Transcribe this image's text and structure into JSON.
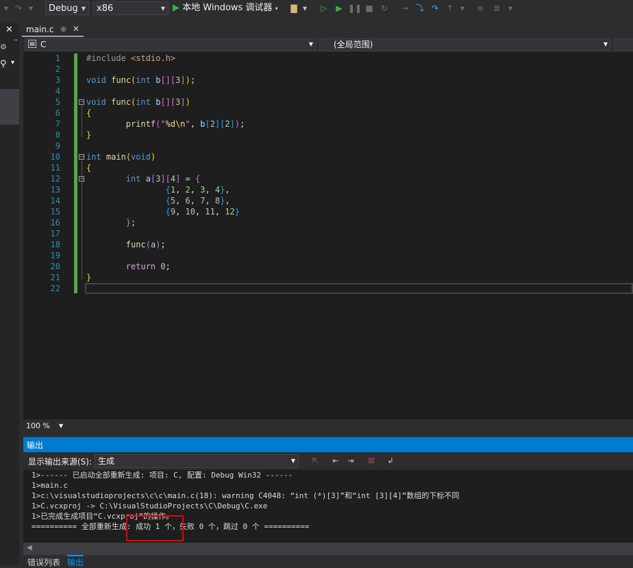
{
  "toolbar": {
    "config": "Debug",
    "platform": "x86",
    "run_label": "本地 Windows 调试器"
  },
  "tab": {
    "title": "main.c",
    "pin": "⊕",
    "close": "✕"
  },
  "left_strip": {
    "close": "✕"
  },
  "navbar": {
    "file": "C",
    "scope": "(全局范围)"
  },
  "editor": {
    "line_numbers": [
      "1",
      "2",
      "3",
      "4",
      "5",
      "6",
      "7",
      "8",
      "9",
      "10",
      "11",
      "12",
      "13",
      "14",
      "15",
      "16",
      "17",
      "18",
      "19",
      "20",
      "21",
      "22"
    ]
  },
  "zoom": "100 %",
  "output": {
    "title": "输出",
    "source_label": "显示输出来源(S):",
    "source_value": "生成",
    "lines": [
      "1>------ 已启动全部重新生成: 项目: C, 配置: Debug Win32 ------",
      "1>main.c",
      "1>c:\\visualstudioprojects\\c\\c\\main.c(18): warning C4048: “int (*)[3]”和“int [3][4]”数组的下标不同",
      "1>C.vcxproj -> C:\\VisualStudioProjects\\C\\Debug\\C.exe",
      "1>已完成生成项目“C.vcxproj”的操作。",
      "========== 全部重新生成: 成功 1 个，失败 0 个，跳过 0 个 =========="
    ]
  },
  "bottom_tabs": [
    "错误列表",
    "输出"
  ],
  "colors": {
    "accent": "#007acc",
    "highlight_box": "#ee0000",
    "change_bar": "#57a64a"
  }
}
